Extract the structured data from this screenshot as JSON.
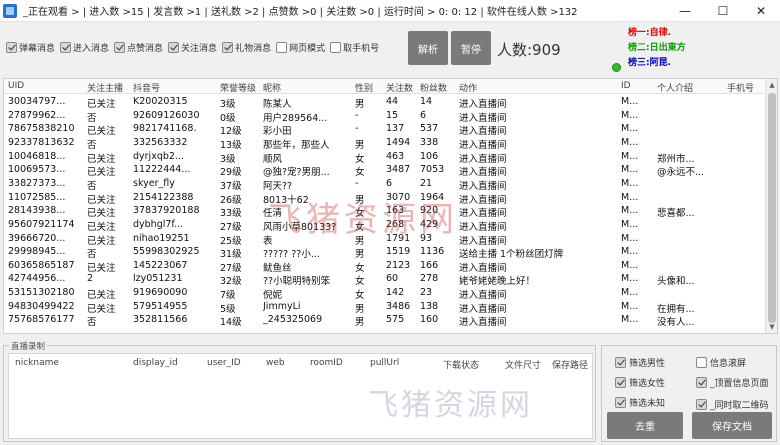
{
  "title": "_正在观看 > | 进入数 >15 | 发言数 >1 | 送礼数 >2 | 点赞数 >0 | 关注数 >0 | 运行时间 >  0: 0: 12 | 软件在线人数 >132",
  "window_controls": {
    "minimize": "—",
    "maximize": "☐",
    "close": "✕"
  },
  "filters": [
    {
      "label": "弹幕消息",
      "checked": true
    },
    {
      "label": "进入消息",
      "checked": true
    },
    {
      "label": "点赞消息",
      "checked": true
    },
    {
      "label": "关注消息",
      "checked": true
    },
    {
      "label": "礼物消息",
      "checked": true
    },
    {
      "label": "网页模式",
      "checked": false
    },
    {
      "label": "取手机号",
      "checked": false
    }
  ],
  "buttons": {
    "parse": "解析",
    "pause": "暂停",
    "clear": "去重",
    "save_doc": "保存文档"
  },
  "viewer_count": "人数:909",
  "rank": {
    "r1_label": "榜一:",
    "r1_value": "自律.",
    "r2_label": "榜二:",
    "r2_value": "日出東方",
    "r3_label": "榜三:",
    "r3_value": "阿昆."
  },
  "table": {
    "columns": [
      "UID",
      "关注主播",
      "抖音号",
      "荣誉等级",
      "昵称",
      "性别",
      "关注数",
      "粉丝数",
      "动作",
      "ID",
      "个人介绍",
      "手机号"
    ],
    "rows": [
      [
        "30034797...",
        "已关注",
        "K20020315",
        "3级",
        "陈某人",
        "男",
        "44",
        "14",
        "进入直播间",
        "M...",
        "",
        ""
      ],
      [
        "27879962...",
        "否",
        "92609126030",
        "0级",
        "用户289564...",
        "-",
        "15",
        "6",
        "进入直播间",
        "M...",
        "",
        ""
      ],
      [
        "78675838210",
        "已关注",
        "9821741168.",
        "12级",
        "彩小田",
        "-",
        "137",
        "537",
        "进入直播间",
        "M...",
        "",
        ""
      ],
      [
        "92337813632",
        "否",
        "332563332",
        "13级",
        "那些年，那些人",
        "男",
        "1494",
        "338",
        "进入直播间",
        "M...",
        "",
        ""
      ],
      [
        "10046818...",
        "已关注",
        "dyrjxqb2...",
        "3级",
        "顺风",
        "女",
        "463",
        "106",
        "进入直播间",
        "M...",
        "郑州市...",
        ""
      ],
      [
        "10069573...",
        "已关注",
        "11222444...",
        "29级",
        "@独?宠?男朋...",
        "女",
        "3487",
        "7053",
        "进入直播间",
        "M...",
        "@永远不...",
        ""
      ],
      [
        "33827373...",
        "否",
        "skyer_fly",
        "37级",
        "阿天??",
        "-",
        "6",
        "21",
        "进入直播间",
        "M...",
        "",
        ""
      ],
      [
        "11072585...",
        "已关注",
        "2154122388",
        "26级",
        "8013十62",
        "男",
        "3070",
        "1964",
        "进入直播间",
        "M...",
        "",
        ""
      ],
      [
        "28143938...",
        "已关注",
        "37837920188",
        "33级",
        "任清",
        "女",
        "163",
        "920",
        "进入直播间",
        "M...",
        "悲喜都...",
        ""
      ],
      [
        "95607921174",
        "已关注",
        "dybhgl7f...",
        "27级",
        "风雨小草80133?",
        "女",
        "268",
        "429",
        "进入直播间",
        "M...",
        "",
        ""
      ],
      [
        "39666720...",
        "已关注",
        "nihao19251",
        "25级",
        "表",
        "男",
        "1791",
        "93",
        "进入直播间",
        "M...",
        "",
        ""
      ],
      [
        "29998945...",
        "否",
        "55998302925",
        "31级",
        "????? ??小...",
        "男",
        "1519",
        "1136",
        "送给主播 1个粉丝团灯牌",
        "M...",
        "",
        ""
      ],
      [
        "60365865187",
        "已关注",
        "145223067",
        "27级",
        "鱿鱼丝",
        "女",
        "2123",
        "166",
        "进入直播间",
        "M...",
        "",
        ""
      ],
      [
        "42744956...",
        "2",
        "lzy051231",
        "32级",
        "??小聪明特别笨",
        "女",
        "60",
        "278",
        "姥爷姥姥晚上好！",
        "M...",
        "头像和...",
        ""
      ],
      [
        "53151302180",
        "已关注",
        "919690090",
        "7级",
        "倪妮",
        "女",
        "142",
        "23",
        "进入直播间",
        "M...",
        "",
        ""
      ],
      [
        "94830499422",
        "已关注",
        "579514955",
        "5级",
        "JimmyLi",
        "男",
        "3486",
        "138",
        "进入直播间",
        "M...",
        "在拥有...",
        ""
      ],
      [
        "75768576177",
        "否",
        "352811566",
        "14级",
        "_245325069",
        "男",
        "575",
        "160",
        "进入直播间",
        "M...",
        "没有人...",
        ""
      ]
    ]
  },
  "recording": {
    "group_title": "直播录制",
    "columns": [
      "nickname",
      "display_id",
      "user_ID",
      "web",
      "roomID",
      "pullUrl",
      "下载状态",
      "文件尺寸",
      "保存路径"
    ]
  },
  "options": [
    {
      "label": "筛选男性",
      "checked": true
    },
    {
      "label": "信息滚屏",
      "checked": false
    },
    {
      "label": "筛选女性",
      "checked": true
    },
    {
      "label": "_顶置信息页面",
      "checked": true
    },
    {
      "label": "筛选未知",
      "checked": true
    },
    {
      "label": "_同时取二维码",
      "checked": true
    }
  ],
  "watermark": "飞猪资源网",
  "colors": {
    "rank1": "#e00000",
    "rank2": "#00a000",
    "rank3": "#0000cc",
    "gray_button": "#7a7a7a"
  }
}
